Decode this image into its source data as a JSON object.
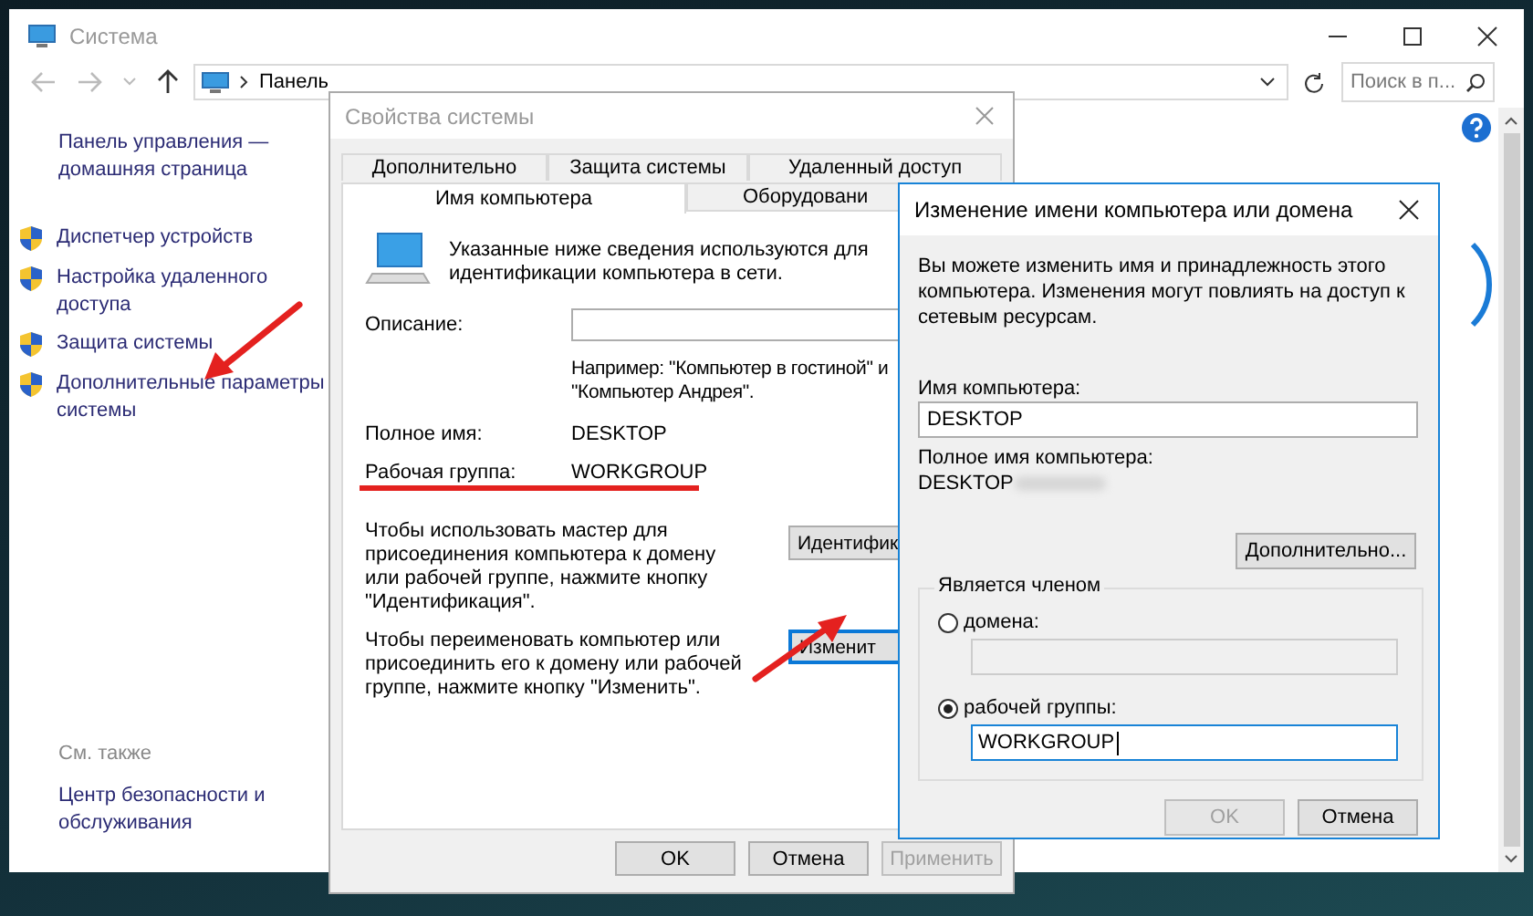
{
  "main_window": {
    "title": "Система",
    "address": "Панель",
    "search": {
      "placeholder": "Поиск в п..."
    },
    "home_link": "Панель управления — домашняя страница",
    "tasks": [
      {
        "label": "Диспетчер устройств"
      },
      {
        "label": "Настройка удаленного доступа"
      },
      {
        "label": "Защита системы"
      },
      {
        "label": "Дополнительные параметры системы"
      }
    ],
    "see_also": {
      "heading": "См. также",
      "links": [
        "Центр безопасности и обслуживания"
      ]
    }
  },
  "system_properties": {
    "title": "Свойства системы",
    "tab_rows": [
      [
        {
          "label": "Дополнительно",
          "selected": false
        },
        {
          "label": "Защита системы",
          "selected": false
        },
        {
          "label": "Удаленный доступ",
          "selected": false
        }
      ],
      [
        {
          "label": "Имя компьютера",
          "selected": true
        },
        {
          "label": "Оборудовани",
          "selected": false
        }
      ]
    ],
    "intro": "Указанные ниже сведения используются для идентификации компьютера в сети.",
    "description_label": "Описание:",
    "description_hint": [
      "Например: \"Компьютер в гостиной\" и",
      "\"Компьютер Андрея\"."
    ],
    "full_name": {
      "label": "Полное имя:",
      "value": "DESKTOP"
    },
    "workgroup": {
      "label": "Рабочая группа:",
      "value": "WORKGROUP"
    },
    "actions": [
      {
        "text": "Чтобы использовать мастер для присоединения компьютера к домену или рабочей группе, нажмите кнопку \"Идентификация\".",
        "button": "Идентифик",
        "focused": false
      },
      {
        "text": "Чтобы переименовать компьютер или присоединить его к домену или рабочей группе, нажмите кнопку \"Изменить\".",
        "button": "Изменит",
        "focused": true
      }
    ],
    "buttons": [
      {
        "label": "OK",
        "disabled": false
      },
      {
        "label": "Отмена",
        "disabled": false
      },
      {
        "label": "Применить",
        "disabled": true
      }
    ]
  },
  "rename_dialog": {
    "title": "Изменение имени компьютера или домена",
    "intro": "Вы можете изменить имя и принадлежность этого компьютера. Изменения могут повлиять на доступ к сетевым ресурсам.",
    "name_label": "Имя компьютера:",
    "name_value": "DESKTOP",
    "full_name_label": "Полное имя компьютера:",
    "full_name_value": "DESKTOP",
    "more_button": "Дополнительно...",
    "member_of": {
      "heading": "Является членом",
      "options": [
        {
          "label": "домена:",
          "selected": false
        },
        {
          "label": "рабочей группы:",
          "selected": true,
          "value": "WORKGROUP"
        }
      ]
    },
    "buttons": [
      {
        "label": "OK",
        "disabled": true
      },
      {
        "label": "Отмена",
        "disabled": false
      }
    ]
  }
}
